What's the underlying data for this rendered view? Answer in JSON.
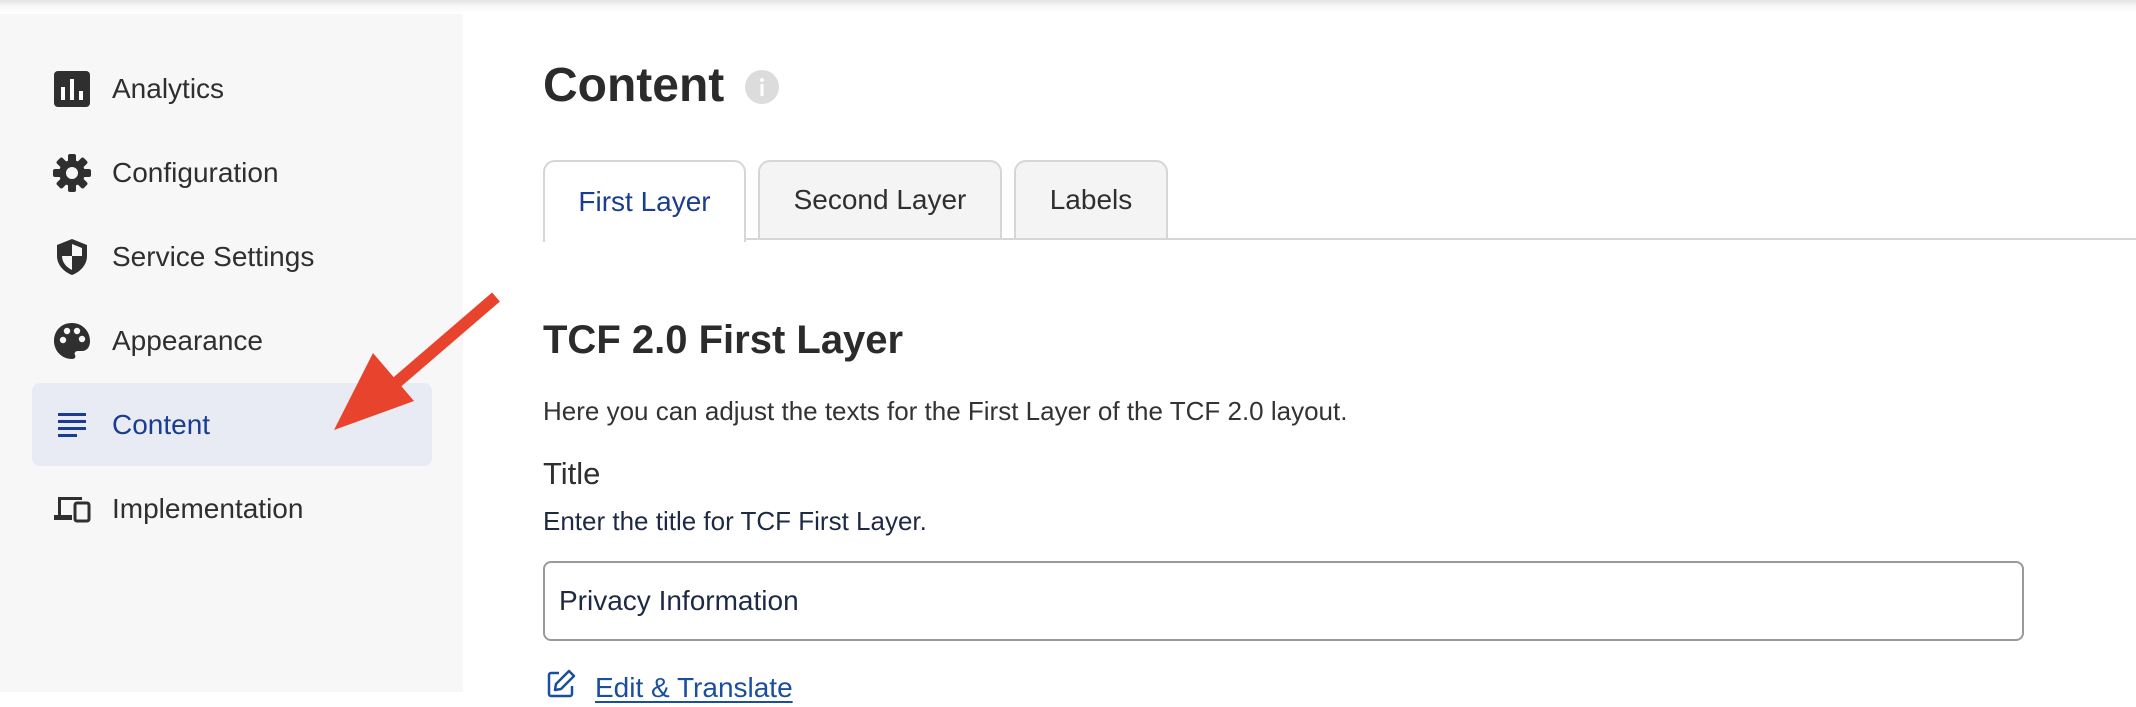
{
  "sidebar": {
    "items": [
      {
        "label": "Analytics",
        "icon": "bar-chart-icon"
      },
      {
        "label": "Configuration",
        "icon": "gear-icon"
      },
      {
        "label": "Service Settings",
        "icon": "shield-icon"
      },
      {
        "label": "Appearance",
        "icon": "palette-icon"
      },
      {
        "label": "Content",
        "icon": "text-lines-icon",
        "active": true
      },
      {
        "label": "Implementation",
        "icon": "devices-icon"
      }
    ]
  },
  "main": {
    "title": "Content",
    "tabs": [
      {
        "label": "First Layer",
        "active": true
      },
      {
        "label": "Second Layer"
      },
      {
        "label": "Labels"
      }
    ],
    "section": {
      "title": "TCF 2.0 First Layer",
      "description": "Here you can adjust the texts for the First Layer of the TCF 2.0 layout."
    },
    "title_field": {
      "label": "Title",
      "help": "Enter the title for TCF First Layer.",
      "value": "Privacy Information"
    },
    "edit_link": "Edit & Translate"
  },
  "colors": {
    "accent": "#1a3d8f",
    "active_nav_bg": "#e8ebf3",
    "annotation_arrow": "#e8432c"
  }
}
